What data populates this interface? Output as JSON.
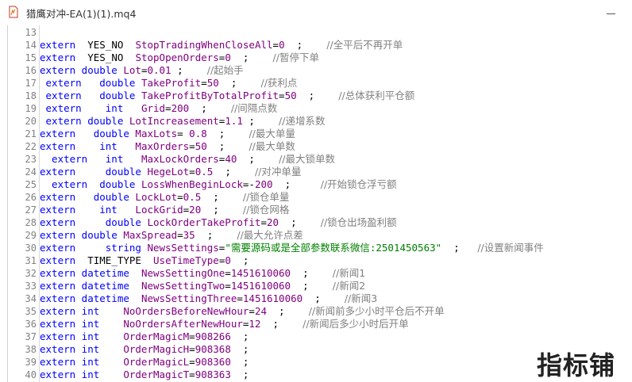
{
  "window": {
    "title": "猎鹰对冲-EA(1)(1).mq4"
  },
  "watermark": "指标铺",
  "lines": [
    {
      "n": "13",
      "parts": []
    },
    {
      "n": "14",
      "parts": [
        [
          "kw",
          "extern  "
        ],
        [
          "ty",
          "YES_NO  "
        ],
        [
          "id",
          "StopTradingWhenCloseAll"
        ],
        [
          "op",
          "="
        ],
        [
          "num",
          "0"
        ],
        [
          "op",
          "  ;    "
        ],
        [
          "cm",
          "//全平后不再开单"
        ]
      ]
    },
    {
      "n": "15",
      "parts": [
        [
          "kw",
          "extern  "
        ],
        [
          "ty",
          "YES_NO  "
        ],
        [
          "id",
          "StopOpenOrders"
        ],
        [
          "op",
          "="
        ],
        [
          "num",
          "0"
        ],
        [
          "op",
          "  ;    "
        ],
        [
          "cm",
          "//暂停下单"
        ]
      ]
    },
    {
      "n": "16",
      "parts": [
        [
          "kw",
          "extern double "
        ],
        [
          "id",
          "Lot"
        ],
        [
          "op",
          "="
        ],
        [
          "num",
          "0.01"
        ],
        [
          "op",
          " ;    "
        ],
        [
          "cm",
          "//起始手"
        ]
      ]
    },
    {
      "n": "17",
      "parts": [
        [
          "kw",
          " extern   double "
        ],
        [
          "id",
          "TakeProfit"
        ],
        [
          "op",
          "="
        ],
        [
          "num",
          "50"
        ],
        [
          "op",
          "  ;    "
        ],
        [
          "cm",
          "//获利点"
        ]
      ]
    },
    {
      "n": "18",
      "parts": [
        [
          "kw",
          " extern   double "
        ],
        [
          "id",
          "TakeProfitByTotalProfit"
        ],
        [
          "op",
          "="
        ],
        [
          "num",
          "50"
        ],
        [
          "op",
          "  ;    "
        ],
        [
          "cm",
          "//总体获利平仓额"
        ]
      ]
    },
    {
      "n": "19",
      "parts": [
        [
          "kw",
          " extern    int   "
        ],
        [
          "id",
          "Grid"
        ],
        [
          "op",
          "="
        ],
        [
          "num",
          "200"
        ],
        [
          "op",
          "  ;    "
        ],
        [
          "cm",
          "//间隔点数"
        ]
      ]
    },
    {
      "n": "20",
      "parts": [
        [
          "kw",
          " extern double "
        ],
        [
          "id",
          "LotIncreasement"
        ],
        [
          "op",
          "="
        ],
        [
          "num",
          "1.1"
        ],
        [
          "op",
          " ;    "
        ],
        [
          "cm",
          "//递增系数"
        ]
      ]
    },
    {
      "n": "21",
      "parts": [
        [
          "kw",
          "extern   double "
        ],
        [
          "id",
          "MaxLots"
        ],
        [
          "op",
          "= "
        ],
        [
          "num",
          "0.8"
        ],
        [
          "op",
          "  ;    "
        ],
        [
          "cm",
          "//最大单量"
        ]
      ]
    },
    {
      "n": "22",
      "parts": [
        [
          "kw",
          "extern    int   "
        ],
        [
          "id",
          "MaxOrders"
        ],
        [
          "op",
          "="
        ],
        [
          "num",
          "50"
        ],
        [
          "op",
          "  ;    "
        ],
        [
          "cm",
          "//最大单数"
        ]
      ]
    },
    {
      "n": "23",
      "parts": [
        [
          "kw",
          "  extern   int   "
        ],
        [
          "id",
          "MaxLockOrders"
        ],
        [
          "op",
          "="
        ],
        [
          "num",
          "40"
        ],
        [
          "op",
          "  ;    "
        ],
        [
          "cm",
          "//最大锁单数"
        ]
      ]
    },
    {
      "n": "24",
      "parts": [
        [
          "kw",
          "extern     double "
        ],
        [
          "id",
          "HegeLot"
        ],
        [
          "op",
          "="
        ],
        [
          "num",
          "0.5"
        ],
        [
          "op",
          "  ;    "
        ],
        [
          "cm",
          "//对冲单量"
        ]
      ]
    },
    {
      "n": "25",
      "parts": [
        [
          "kw",
          "  extern  double "
        ],
        [
          "id",
          "LossWhenBeginLock"
        ],
        [
          "op",
          "=-"
        ],
        [
          "num",
          "200"
        ],
        [
          "op",
          "  ;     "
        ],
        [
          "cm",
          "//开始锁仓浮亏额"
        ]
      ]
    },
    {
      "n": "26",
      "parts": [
        [
          "kw",
          "extern   double "
        ],
        [
          "id",
          "LockLot"
        ],
        [
          "op",
          "="
        ],
        [
          "num",
          "0.5"
        ],
        [
          "op",
          "  ;    "
        ],
        [
          "cm",
          "//锁仓单量"
        ]
      ]
    },
    {
      "n": "27",
      "parts": [
        [
          "kw",
          "extern    int   "
        ],
        [
          "id",
          "LockGrid"
        ],
        [
          "op",
          "="
        ],
        [
          "num",
          "20"
        ],
        [
          "op",
          "  ;    "
        ],
        [
          "cm",
          "//锁仓网格"
        ]
      ]
    },
    {
      "n": "28",
      "parts": [
        [
          "kw",
          "extern     double "
        ],
        [
          "id",
          "LockOrderTakeProfit"
        ],
        [
          "op",
          "="
        ],
        [
          "num",
          "20"
        ],
        [
          "op",
          "  ;    "
        ],
        [
          "cm",
          "//锁仓出场盈利额"
        ]
      ]
    },
    {
      "n": "29",
      "parts": [
        [
          "kw",
          "extern double "
        ],
        [
          "id",
          "MaxSpread"
        ],
        [
          "op",
          "="
        ],
        [
          "num",
          "35"
        ],
        [
          "op",
          "  ;    "
        ],
        [
          "cm",
          "//最大允许点差"
        ]
      ]
    },
    {
      "n": "30",
      "parts": [
        [
          "kw",
          "extern     string "
        ],
        [
          "id",
          "NewsSettings"
        ],
        [
          "op",
          "="
        ],
        [
          "str",
          "\"需要源码或是全部参数联系微信:2501450563\""
        ],
        [
          "op",
          "  ;   "
        ],
        [
          "cm",
          "//设置新闻事件"
        ]
      ]
    },
    {
      "n": "31",
      "parts": [
        [
          "kw",
          "extern  "
        ],
        [
          "ty",
          "TIME_TYPE  "
        ],
        [
          "id",
          "UseTimeType"
        ],
        [
          "op",
          "="
        ],
        [
          "num",
          "0"
        ],
        [
          "op",
          "  ;"
        ]
      ]
    },
    {
      "n": "32",
      "parts": [
        [
          "kw",
          "extern datetime  "
        ],
        [
          "id",
          "NewsSettingOne"
        ],
        [
          "op",
          "="
        ],
        [
          "num",
          "1451610060"
        ],
        [
          "op",
          "  ;    "
        ],
        [
          "cm",
          "//新闻1"
        ]
      ]
    },
    {
      "n": "33",
      "parts": [
        [
          "kw",
          "extern datetime  "
        ],
        [
          "id",
          "NewsSettingTwo"
        ],
        [
          "op",
          "="
        ],
        [
          "num",
          "1451610060"
        ],
        [
          "op",
          "  ;    "
        ],
        [
          "cm",
          "//新闻2"
        ]
      ]
    },
    {
      "n": "34",
      "parts": [
        [
          "kw",
          "extern datetime  "
        ],
        [
          "id",
          "NewsSettingThree"
        ],
        [
          "op",
          "="
        ],
        [
          "num",
          "1451610060"
        ],
        [
          "op",
          "  ;    "
        ],
        [
          "cm",
          "//新闻3"
        ]
      ]
    },
    {
      "n": "35",
      "parts": [
        [
          "kw",
          "extern int    "
        ],
        [
          "id",
          "NoOrdersBeforeNewHour"
        ],
        [
          "op",
          "="
        ],
        [
          "num",
          "24"
        ],
        [
          "op",
          "  ;    "
        ],
        [
          "cm",
          "//新闻前多少小时平仓后不开单"
        ]
      ]
    },
    {
      "n": "36",
      "parts": [
        [
          "kw",
          "extern int    "
        ],
        [
          "id",
          "NoOrdersAfterNewHour"
        ],
        [
          "op",
          "="
        ],
        [
          "num",
          "12"
        ],
        [
          "op",
          "  ;    "
        ],
        [
          "cm",
          "//新闻后多少小时后开单"
        ]
      ]
    },
    {
      "n": "37",
      "parts": [
        [
          "kw",
          "extern int    "
        ],
        [
          "id",
          "OrderMagicM"
        ],
        [
          "op",
          "="
        ],
        [
          "num",
          "908266"
        ],
        [
          "op",
          "  ;"
        ]
      ]
    },
    {
      "n": "38",
      "parts": [
        [
          "kw",
          "extern int    "
        ],
        [
          "id",
          "OrderMagicH"
        ],
        [
          "op",
          "="
        ],
        [
          "num",
          "908368"
        ],
        [
          "op",
          "  ;"
        ]
      ]
    },
    {
      "n": "39",
      "parts": [
        [
          "kw",
          "extern int    "
        ],
        [
          "id",
          "OrderMagicL"
        ],
        [
          "op",
          "="
        ],
        [
          "num",
          "908360"
        ],
        [
          "op",
          "  ;"
        ]
      ]
    },
    {
      "n": "40",
      "parts": [
        [
          "kw",
          "extern int    "
        ],
        [
          "id",
          "OrderMagicT"
        ],
        [
          "op",
          "="
        ],
        [
          "num",
          "908363"
        ],
        [
          "op",
          "  ;"
        ]
      ]
    }
  ]
}
